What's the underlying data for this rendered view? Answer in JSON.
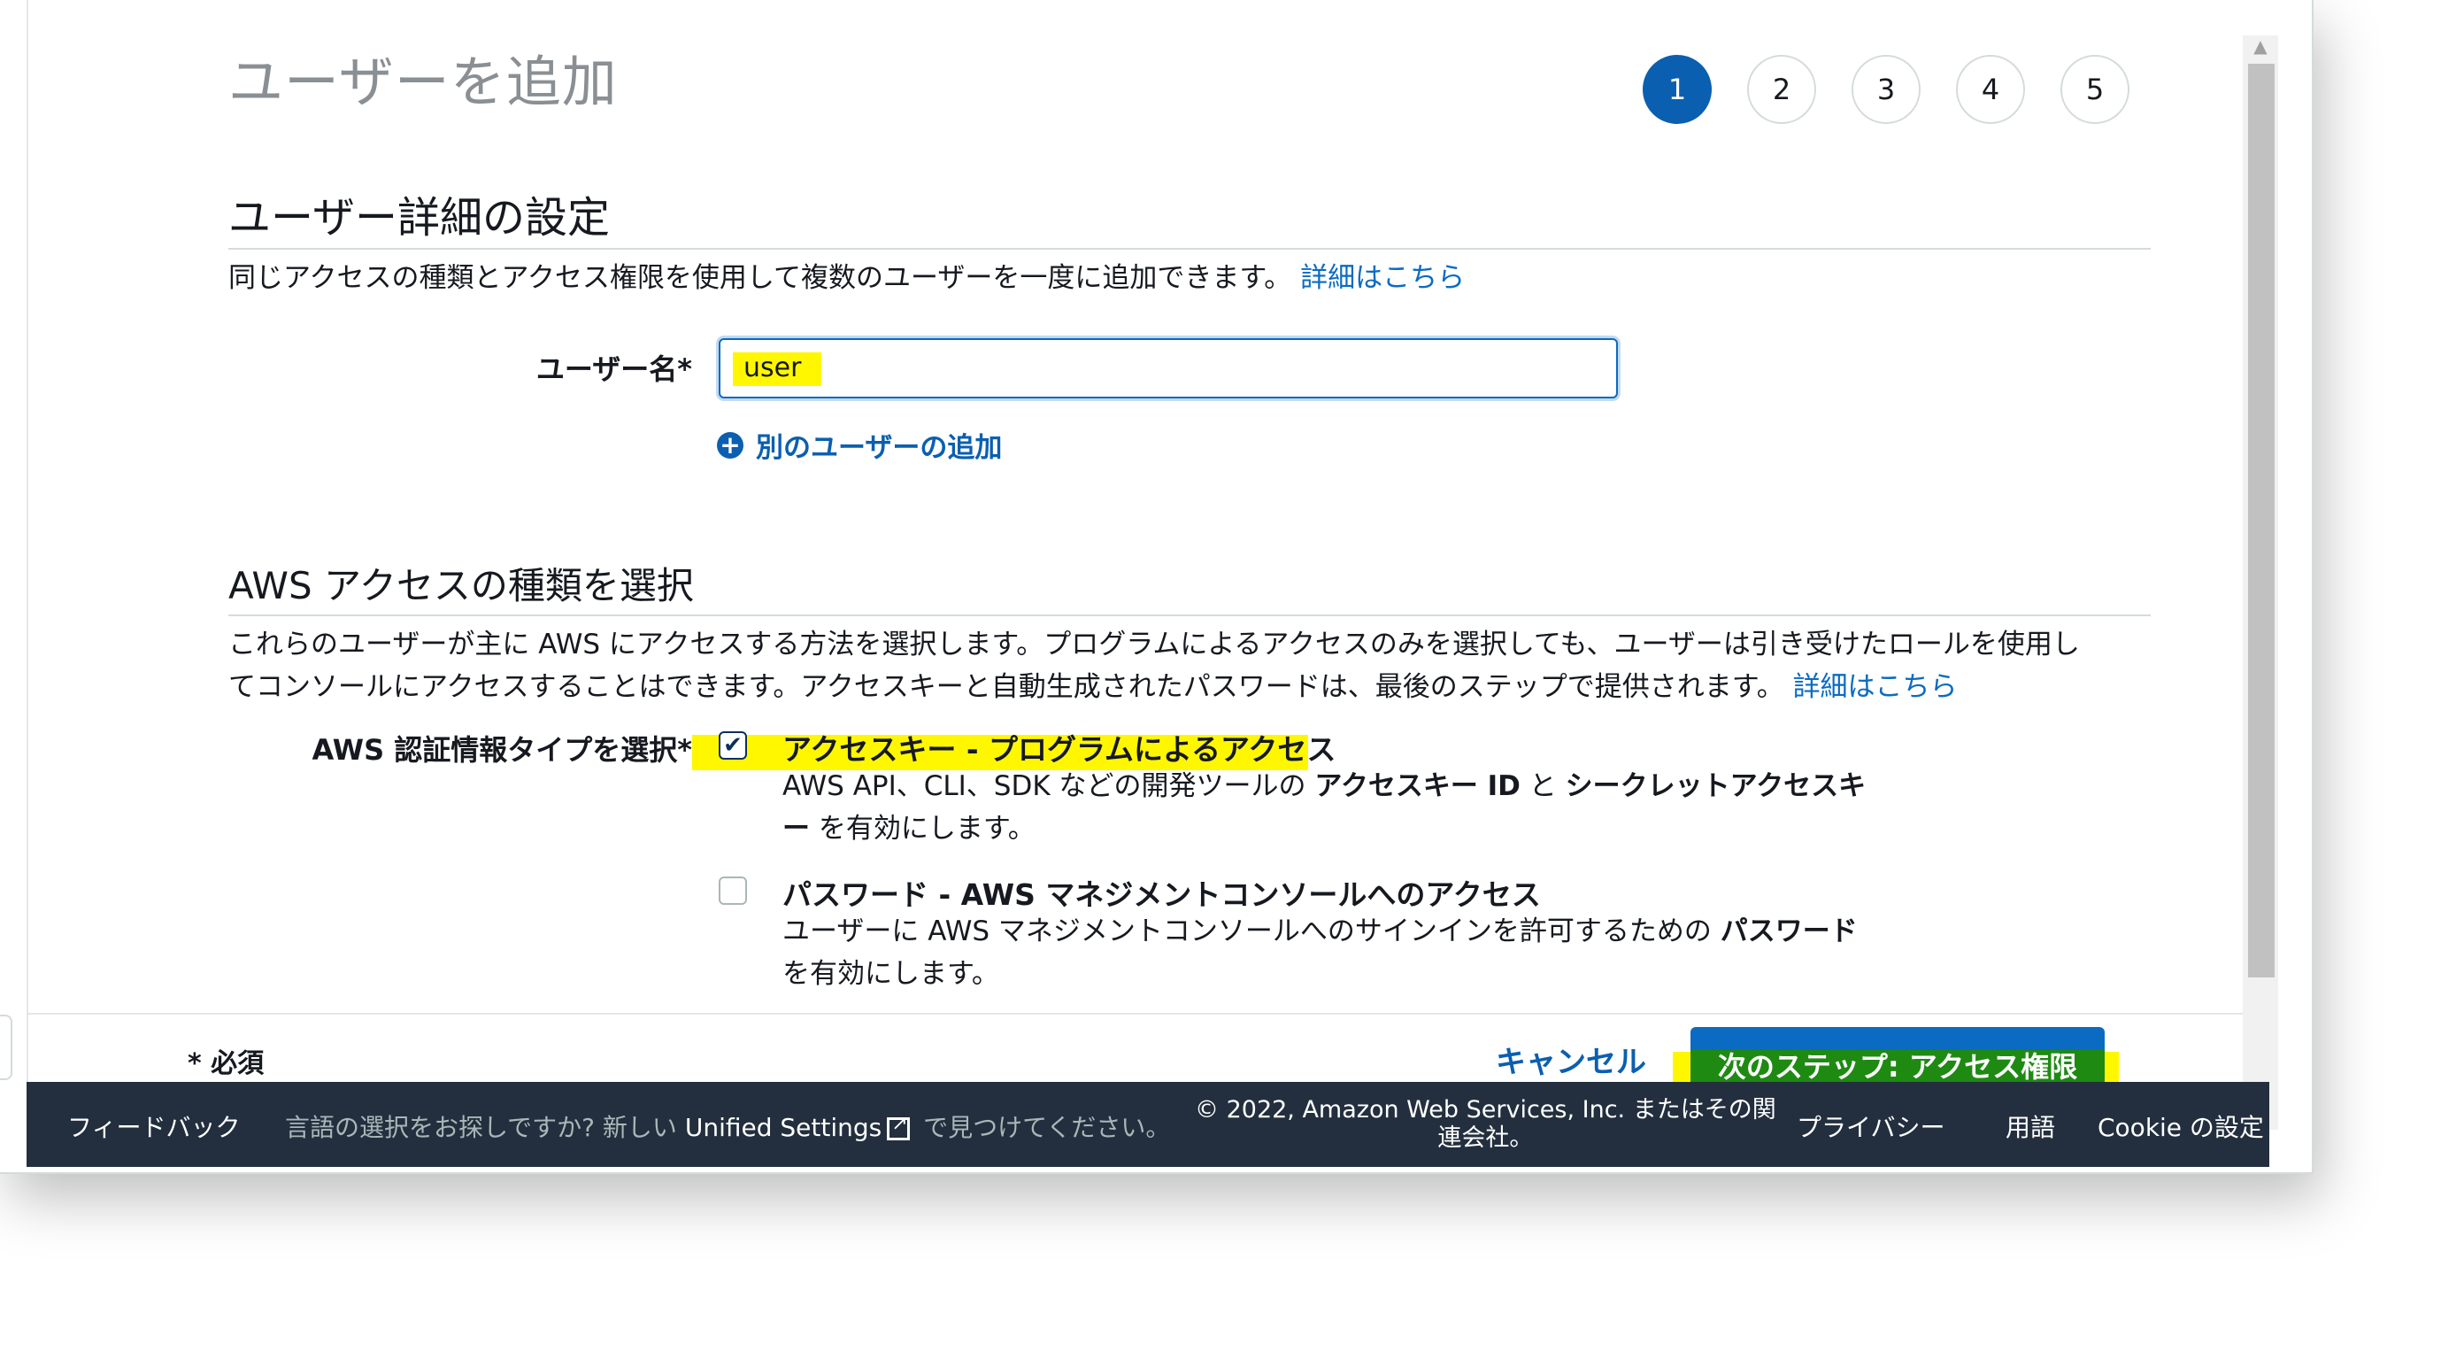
{
  "header": {
    "title": "ユーザーを追加",
    "steps": [
      "1",
      "2",
      "3",
      "4",
      "5"
    ],
    "active_step": "1"
  },
  "user_details": {
    "title": "ユーザー詳細の設定",
    "description": "同じアクセスの種類とアクセス権限を使用して複数のユーザーを一度に追加できます。",
    "learn_more": "詳細はこちら",
    "username_label": "ユーザー名*",
    "username_value": "user",
    "add_user_label": "別のユーザーの追加"
  },
  "access_type": {
    "title": "AWS アクセスの種類を選択",
    "description_line1": "これらのユーザーが主に AWS にアクセスする方法を選択します。プログラムによるアクセスのみを選択しても、ユーザーは引き受けたロールを使用し",
    "description_line2": "てコンソールにアクセスすることはできます。アクセスキーと自動生成されたパスワードは、最後のステップで提供されます。",
    "learn_more": "詳細はこちら",
    "credential_label": "AWS 認証情報タイプを選択*",
    "options": [
      {
        "checked": true,
        "title": "アクセスキー - プログラムによるアクセス",
        "desc_a": "AWS API、CLI、SDK などの開発ツールの ",
        "desc_b": "アクセスキー ID",
        "desc_c": " と ",
        "desc_d": "シークレットアクセスキ",
        "desc_e": "ー",
        "desc_f": " を有効にします。"
      },
      {
        "checked": false,
        "title": "パスワード - AWS マネジメントコンソールへのアクセス",
        "desc_a": "ユーザーに AWS マネジメントコンソールへのサインインを許可するための ",
        "desc_b": "パスワード",
        "desc_c": "を有効にします。"
      }
    ]
  },
  "actions": {
    "required_note": "* 必須",
    "cancel": "キャンセル",
    "next": "次のステップ: アクセス権限"
  },
  "footer": {
    "feedback": "フィードバック",
    "lang_text": "言語の選択をお探しですか? 新しい",
    "unified_settings": "Unified Settings",
    "lang_suffix": "で見つけてください。",
    "copyright_line1": "© 2022, Amazon Web Services, Inc. またはその関",
    "copyright_line2": "連会社。",
    "privacy": "プライバシー",
    "terms": "用語",
    "cookie": "Cookie の設定"
  },
  "colors": {
    "primary": "#0b6bc2",
    "footer_bg": "#232f3e",
    "highlight": "#fff700"
  }
}
